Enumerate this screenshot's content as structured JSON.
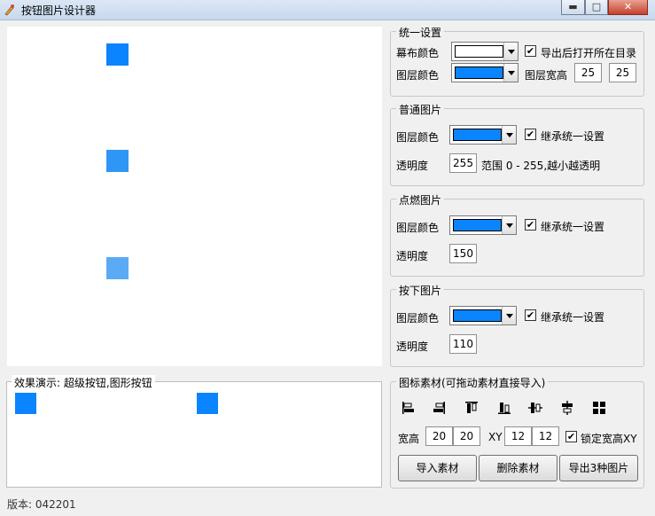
{
  "window": {
    "title": "按钮图片设计器",
    "min_glyph": "▬",
    "max_glyph": "□",
    "close_glyph": "✕"
  },
  "canvas": {
    "squares": [
      {
        "color": "#0a84ff"
      },
      {
        "color": "#2f96f5"
      },
      {
        "color": "#5aaaf5"
      }
    ]
  },
  "demo": {
    "label": "效果演示: 超级按钮,图形按钮",
    "squares": [
      {
        "color": "#0a84ff"
      },
      {
        "color": "#0a84ff"
      }
    ]
  },
  "unified": {
    "legend": "统一设置",
    "canvas_color_label": "幕布颜色",
    "canvas_color": "#ffffff",
    "open_dir_label": "导出后打开所在目录",
    "open_dir_checked": "✔",
    "layer_color_label": "图层颜色",
    "layer_color": "#0a84ff",
    "size_label": "图层宽高",
    "width": "25",
    "height": "25"
  },
  "normal": {
    "legend": "普通图片",
    "layer_color_label": "图层颜色",
    "layer_color": "#0a84ff",
    "inherit_label": "继承统一设置",
    "inherit_checked": "✔",
    "opacity_label": "透明度",
    "opacity": "255",
    "range_text": "范围 0 - 255,越小越透明"
  },
  "hover": {
    "legend": "点燃图片",
    "layer_color_label": "图层颜色",
    "layer_color": "#0a84ff",
    "inherit_label": "继承统一设置",
    "inherit_checked": "✔",
    "opacity_label": "透明度",
    "opacity": "150"
  },
  "pressed": {
    "legend": "按下图片",
    "layer_color_label": "图层颜色",
    "layer_color": "#0a84ff",
    "inherit_label": "继承统一设置",
    "inherit_checked": "✔",
    "opacity_label": "透明度",
    "opacity": "110"
  },
  "material": {
    "legend": "图标素材(可拖动素材直接导入)",
    "tools": [
      "align-left-icon",
      "align-right-icon",
      "align-top-icon",
      "align-bottom-icon",
      "center-horizontal-icon",
      "center-vertical-icon",
      "grid-icon"
    ],
    "size_label": "宽高",
    "width": "20",
    "height": "20",
    "xy_label": "XY",
    "x": "12",
    "y": "12",
    "lock_label": "锁定宽高XY",
    "lock_checked": "✔",
    "import_button": "导入素材",
    "delete_button": "删除素材",
    "export_button": "导出3种图片"
  },
  "status": {
    "version": "版本: 042201"
  }
}
